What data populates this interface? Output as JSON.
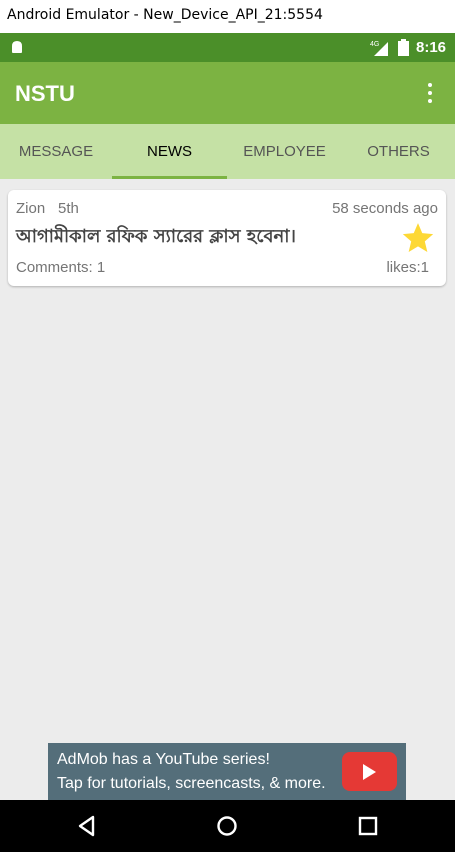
{
  "window": {
    "title": "Android Emulator - New_Device_API_21:5554"
  },
  "status_bar": {
    "network": "4G",
    "time": "8:16"
  },
  "toolbar": {
    "title": "NSTU",
    "overflow_icon": "more-vert-icon"
  },
  "tabs": [
    {
      "label": "MESSAGE",
      "active": false
    },
    {
      "label": "NEWS",
      "active": true
    },
    {
      "label": "EMPLOYEE",
      "active": false
    },
    {
      "label": "OTHERS",
      "active": false
    }
  ],
  "news": [
    {
      "author": "Zion",
      "batch": "5th",
      "time_ago": "58 seconds ago",
      "text": "আগামীকাল রফিক স্যারের ক্লাস হবেনা।",
      "comments": "Comments: 1",
      "likes": "likes:1",
      "starred": true
    }
  ],
  "ad": {
    "line1": "AdMob has a YouTube series!",
    "line2": "Tap for tutorials, screencasts, & more.",
    "icon": "youtube-play-icon"
  },
  "colors": {
    "status_bar": "#4b8f29",
    "toolbar": "#7cb342",
    "tabs": "#c5e1a5",
    "background": "#ececec",
    "star": "#fdd835"
  }
}
